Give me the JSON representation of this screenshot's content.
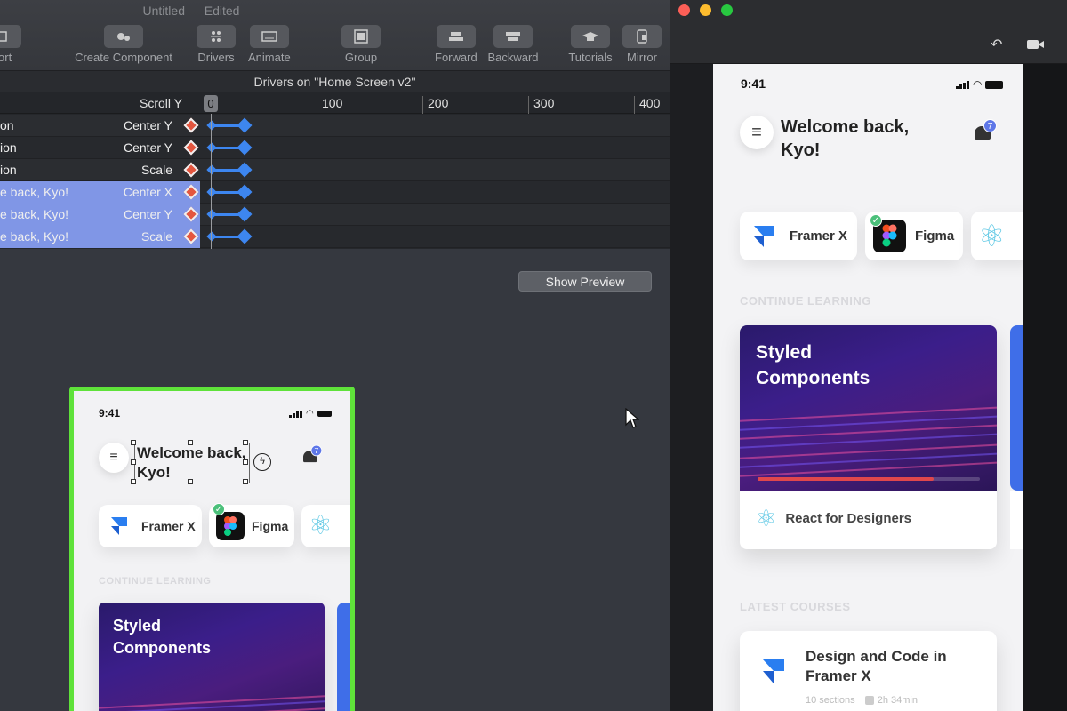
{
  "editor": {
    "document_title": "Untitled — Edited",
    "toolbar": [
      {
        "label": "port",
        "icon": "import-icon"
      },
      {
        "label": "Create Component",
        "icon": "gears-icon"
      },
      {
        "label": "Drivers",
        "icon": "drivers-icon"
      },
      {
        "label": "Animate",
        "icon": "animate-icon"
      },
      {
        "label": "Group",
        "icon": "group-icon"
      },
      {
        "label": "Forward",
        "icon": "forward-icon"
      },
      {
        "label": "Backward",
        "icon": "backward-icon"
      },
      {
        "label": "Tutorials",
        "icon": "graduation-cap-icon"
      },
      {
        "label": "Mirror",
        "icon": "mirror-icon"
      }
    ],
    "drivers_panel": {
      "title": "Drivers on \"Home Screen v2\"",
      "scroll_label": "Scroll Y",
      "playhead": "0",
      "ruler_ticks": [
        "100",
        "200",
        "300",
        "400"
      ],
      "rows": [
        {
          "name": "on",
          "property": "Center Y",
          "selected": false
        },
        {
          "name": "ion",
          "property": "Center Y",
          "selected": false
        },
        {
          "name": "ion",
          "property": "Scale",
          "selected": false
        },
        {
          "name": "e back, Kyo!",
          "property": "Center X",
          "selected": true
        },
        {
          "name": "e back, Kyo!",
          "property": "Center Y",
          "selected": true
        },
        {
          "name": "e back, Kyo!",
          "property": "Scale",
          "selected": true
        }
      ]
    },
    "show_preview_label": "Show Preview",
    "canvas": {
      "time": "9:41",
      "welcome": "Welcome back, Kyo!",
      "badge": "7",
      "chips": [
        "Framer X",
        "Figma"
      ],
      "section": "CONTINUE LEARNING",
      "course_title": "Styled Components"
    }
  },
  "preview": {
    "time": "9:41",
    "welcome": "Welcome back, Kyo!",
    "badge": "7",
    "chips": [
      "Framer X",
      "Figma"
    ],
    "continue_label": "CONTINUE LEARNING",
    "course_title": "Styled Components",
    "course_subtitle": "React for Designers",
    "course_progress": 0.79,
    "latest_label": "LATEST COURSES",
    "latest_course": {
      "title": "Design and Code in Framer X",
      "sections": "10 sections",
      "duration": "2h 34min"
    }
  },
  "colors": {
    "selection": "#8096e6",
    "accent_blue": "#3d86f0",
    "keyframe_red": "#e4563f",
    "canvas_outline": "#5fe23a"
  }
}
